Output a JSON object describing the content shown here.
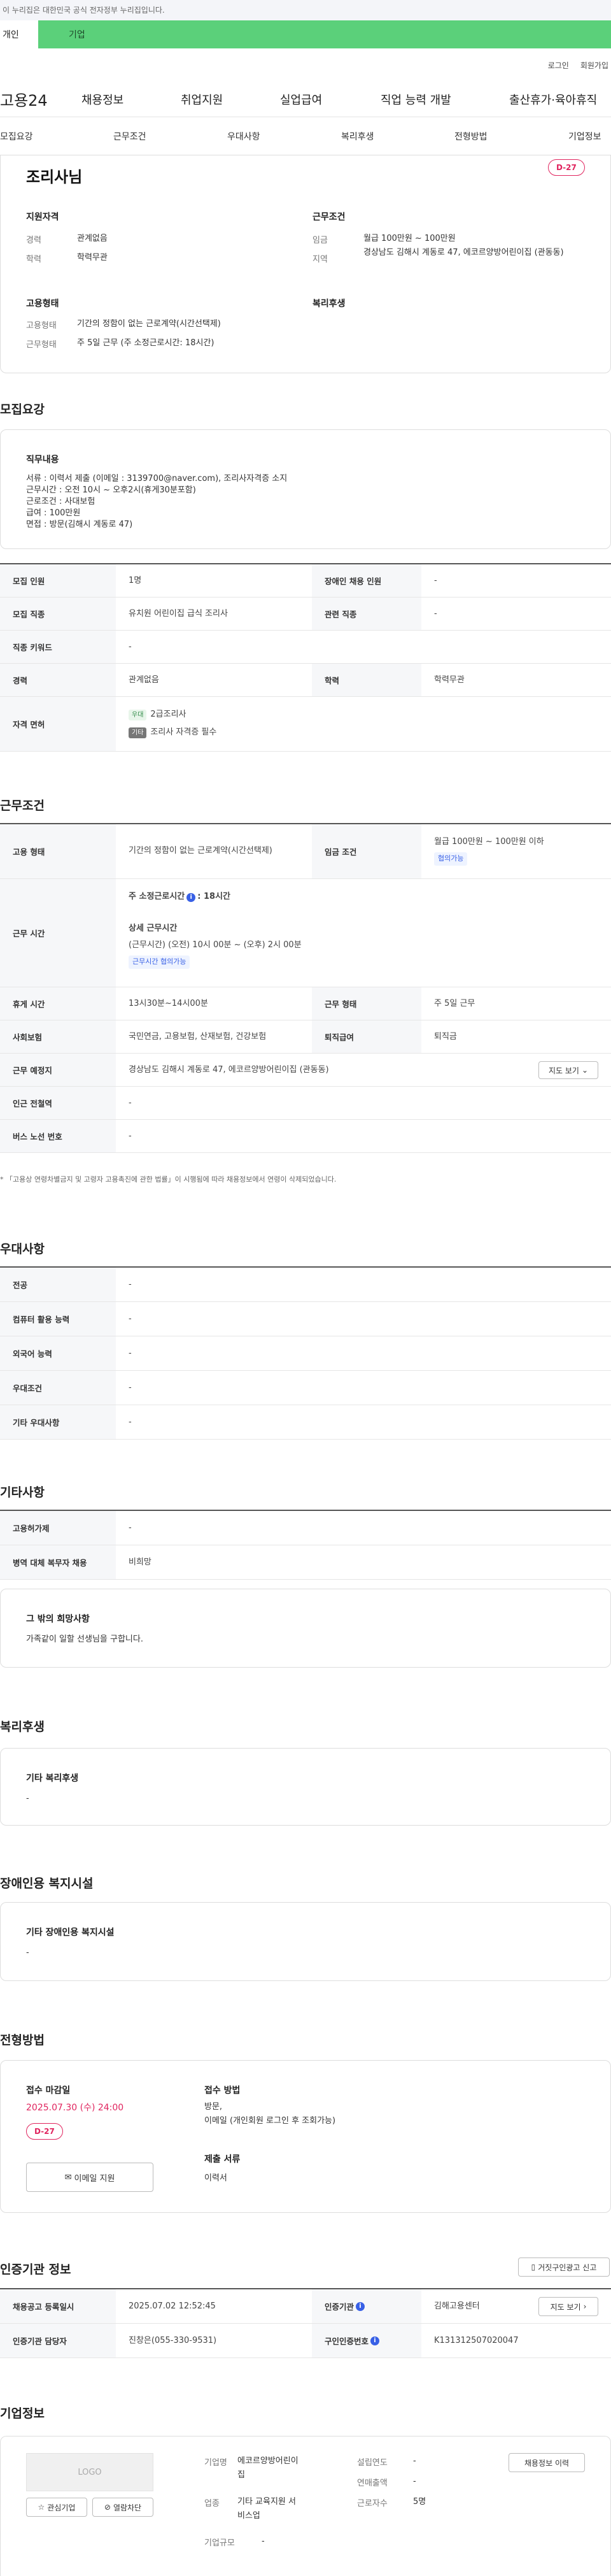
{
  "gov_banner": "이 누리집은 대한민국 공식 전자정부 누리집입니다.",
  "service_tabs": [
    "개인",
    "기업"
  ],
  "util_links": [
    "로그인",
    "회원가입"
  ],
  "logo": "고용24",
  "gnb": [
    "채용정보",
    "취업지원",
    "실업급여",
    "직업 능력 개발",
    "출산휴가·육아휴직"
  ],
  "snb": [
    "모집요강",
    "근무조건",
    "우대사항",
    "복리후생",
    "전형방법",
    "기업정보"
  ],
  "job_title": "조리사님",
  "dday": "D-27",
  "summary": {
    "qual_title": "지원자격",
    "cond_title": "근무조건",
    "emp_title": "고용형태",
    "welfare_title": "복리후생",
    "career_label": "경력",
    "career": "관계없음",
    "edu_label": "학력",
    "edu": "학력무관",
    "wage_label": "임금",
    "wage": "월급 100만원 ~ 100만원",
    "region_label": "지역",
    "region": "경상남도 김해시 계동로 47, 에코르양방어린이집 (관동동)",
    "emptype_label": "고용형태",
    "emptype": "기간의 정함이 없는 근로계약(시간선택제)",
    "hours_label": "근무형태",
    "hours": "주 5일 근무 (주 소정근로시간: 18시간)"
  },
  "recruit": {
    "section": "모집요강",
    "duty_title": "직무내용",
    "duty_lines": [
      "서류 : 이력서 제출 (이메일 : 3139700@naver.com), 조리사자격증 소지",
      "근무시간 : 오전 10시 ~ 오후2시(휴게30분포함)",
      "근로조건 : 사대보험",
      "급여 : 100만원",
      "면접 : 방문(김해시 계동로 47)"
    ],
    "rows": [
      {
        "l1": "모집 인원",
        "v1": "1명",
        "l2": "장애인 채용 인원",
        "v2": "-"
      },
      {
        "l1": "모집 직종",
        "v1": "유치원 어린이집 급식 조리사",
        "l2": "관련 직종",
        "v2": "-"
      },
      {
        "l1": "직종 키워드",
        "v1": "-"
      },
      {
        "l1": "경력",
        "v1": "관계없음",
        "l2": "학력",
        "v2": "학력무관"
      }
    ],
    "license_label": "자격 면허",
    "license_tag1": "우대",
    "license1": "2급조리사",
    "license_tag2": "기타",
    "license2": "조리사 자격증 필수"
  },
  "conditions": {
    "section": "근무조건",
    "emp_label": "고용 형태",
    "emp": "기간의 정함이 없는 근로계약(시간선택제)",
    "wage_label": "임금 조건",
    "wage": "월급 100만원 ~ 100만원 이하",
    "wage_chip": "협의가능",
    "time_label": "근무 시간",
    "weekly": "주 소정근로시간",
    "weekly_val": ": 18시간",
    "detail_title": "상세 근무시간",
    "detail_val": "(근무시간) (오전) 10시 00분 ~ (오후) 2시 00분",
    "time_chip": "근무시간 협의가능",
    "rest_label": "휴게 시간",
    "rest": "13시30분~14시00분",
    "form_label": "근무 형태",
    "form": "주 5일 근무",
    "ins_label": "사회보험",
    "ins": "국민연금, 고용보험, 산재보험, 건강보험",
    "sev_label": "퇴직급여",
    "sev": "퇴직금",
    "place_label": "근무 예정지",
    "place": "경상남도 김해시 계동로 47, 에코르양방어린이집 (관동동)",
    "map_btn": "지도 보기",
    "subway_label": "인근 전철역",
    "subway": "-",
    "bus_label": "버스 노선 번호",
    "bus": "-",
    "note": "* 「고용상 연령차별금지 및 고령자 고용촉진에 관한 법률」이 시행됨에 따라 채용정보에서 연령이 삭제되었습니다."
  },
  "preference": {
    "section": "우대사항",
    "rows": [
      {
        "l": "전공",
        "v": "-"
      },
      {
        "l": "컴퓨터 활용 능력",
        "v": "-"
      },
      {
        "l": "외국어 능력",
        "v": "-"
      },
      {
        "l": "우대조건",
        "v": "-"
      },
      {
        "l": "기타 우대사항",
        "v": "-"
      }
    ]
  },
  "etc": {
    "section": "기타사항",
    "rows": [
      {
        "l": "고용허가제",
        "v": "-"
      },
      {
        "l": "병역 대체 복무자 채용",
        "v": "비희망"
      }
    ],
    "hope_title": "그 밖의 희망사항",
    "hope": "가족같이 일할 선생님을 구합니다."
  },
  "welfare": {
    "section": "복리후생",
    "title": "기타 복리후생",
    "val": "-"
  },
  "disability": {
    "section": "장애인용 복지시설",
    "title": "기타 장애인용 복지시설",
    "val": "-"
  },
  "selection": {
    "section": "전형방법",
    "deadline_title": "접수 마감일",
    "deadline": "2025.07.30 (수) 24:00",
    "dday": "D-27",
    "email_btn": "이메일 지원",
    "method_title": "접수 방법",
    "method_lines": [
      "방문,",
      "이메일 (개인회원 로그인 후 조회가능)"
    ],
    "docs_title": "제출 서류",
    "docs": "이력서"
  },
  "auth": {
    "section": "인증기관 정보",
    "report_btn": "거짓구인광고 신고",
    "reg_label": "채용공고 등록일시",
    "reg": "2025.07.02 12:52:45",
    "org_label": "인증기관",
    "org": "김해고용센터",
    "map_btn": "지도 보기",
    "mgr_label": "인증기관 담당자",
    "mgr": "진창은(055-330-9531)",
    "no_label": "구인인증번호",
    "no": "K131312507020047"
  },
  "company": {
    "section": "기업정보",
    "logo_text": "LOGO",
    "fav_btn": "관심기업",
    "block_btn": "열람차단",
    "name_label": "기업명",
    "name_lines": [
      "에코르양방어린이",
      "집"
    ],
    "ind_label": "업종",
    "ind_lines": [
      "기타 교육지원 서",
      "비스업"
    ],
    "size_label": "기업규모",
    "size": "-",
    "est_label": "설립연도",
    "est": "-",
    "sales_label": "연매출액",
    "sales": "-",
    "emp_label": "근로자수",
    "emp": "5명",
    "history_btn": "채용정보 이력"
  }
}
